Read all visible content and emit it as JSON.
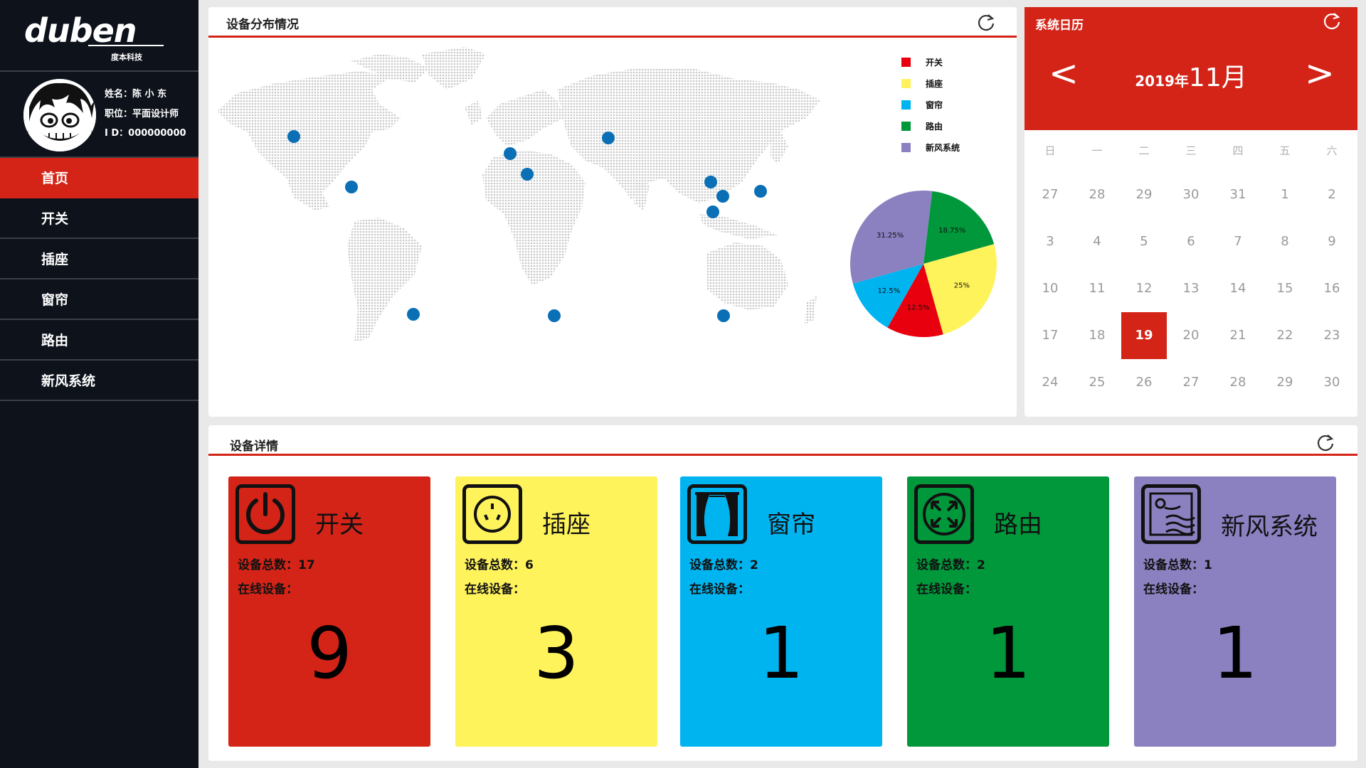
{
  "brand": {
    "wordmark": "duben",
    "company": "度本科技"
  },
  "profile": {
    "name_label": "姓名：",
    "name": "陈 小 东",
    "role_label": "职位：",
    "role": "平面设计师",
    "id_label": "I  D：",
    "id": "000000000"
  },
  "nav": [
    {
      "label": "首页",
      "active": true
    },
    {
      "label": "开关",
      "active": false
    },
    {
      "label": "插座",
      "active": false
    },
    {
      "label": "窗帘",
      "active": false
    },
    {
      "label": "路由",
      "active": false
    },
    {
      "label": "新风系统",
      "active": false
    }
  ],
  "map_panel": {
    "title": "设备分布情况"
  },
  "legend": [
    {
      "name": "开关",
      "color": "#e8000f"
    },
    {
      "name": "插座",
      "color": "#fff35c"
    },
    {
      "name": "窗帘",
      "color": "#00b4f0"
    },
    {
      "name": "路由",
      "color": "#00983b"
    },
    {
      "name": "新风系统",
      "color": "#8b80c0"
    }
  ],
  "chart_data": {
    "type": "pie",
    "slices": [
      {
        "name": "路由",
        "value": 18.75,
        "label": "18.75%",
        "color": "#00983b"
      },
      {
        "name": "插座",
        "value": 25,
        "label": "25%",
        "color": "#fff35c"
      },
      {
        "name": "开关",
        "value": 12.5,
        "label": "12.5%",
        "color": "#e8000f"
      },
      {
        "name": "窗帘",
        "value": 12.5,
        "label": "12.5%",
        "color": "#00b4f0"
      },
      {
        "name": "新风系统",
        "value": 31.25,
        "label": "31.25%",
        "color": "#8b80c0"
      }
    ]
  },
  "calendar": {
    "title": "系统日历",
    "year_label": "2019年",
    "month_label": "11月",
    "prev": "<",
    "next": ">",
    "weekdays": [
      "日",
      "一",
      "二",
      "三",
      "四",
      "五",
      "六"
    ],
    "weeks": [
      [
        "27",
        "28",
        "29",
        "30",
        "31",
        "1",
        "2"
      ],
      [
        "3",
        "4",
        "5",
        "6",
        "7",
        "8",
        "9"
      ],
      [
        "10",
        "11",
        "12",
        "13",
        "14",
        "15",
        "16"
      ],
      [
        "17",
        "18",
        "19",
        "20",
        "21",
        "22",
        "23"
      ],
      [
        "24",
        "25",
        "26",
        "27",
        "28",
        "29",
        "30"
      ]
    ],
    "today": "19"
  },
  "detail_panel": {
    "title": "设备详情"
  },
  "devices": [
    {
      "name": "开关",
      "total_label": "设备总数：",
      "total": "17",
      "online_label": "在线设备：",
      "online": "9",
      "color": "#d42418",
      "icon": "power-icon"
    },
    {
      "name": "插座",
      "total_label": "设备总数：",
      "total": "6",
      "online_label": "在线设备：",
      "online": "3",
      "color": "#fff35c",
      "icon": "socket-icon"
    },
    {
      "name": "窗帘",
      "total_label": "设备总数：",
      "total": "2",
      "online_label": "在线设备：",
      "online": "1",
      "color": "#00b4f0",
      "icon": "curtain-icon"
    },
    {
      "name": "路由",
      "total_label": "设备总数：",
      "total": "2",
      "online_label": "在线设备：",
      "online": "1",
      "color": "#00983b",
      "icon": "router-icon"
    },
    {
      "name": "新风系统",
      "total_label": "设备总数：",
      "total": "1",
      "online_label": "在线设备：",
      "online": "1",
      "color": "#8b80c0",
      "icon": "ventilation-icon"
    }
  ]
}
